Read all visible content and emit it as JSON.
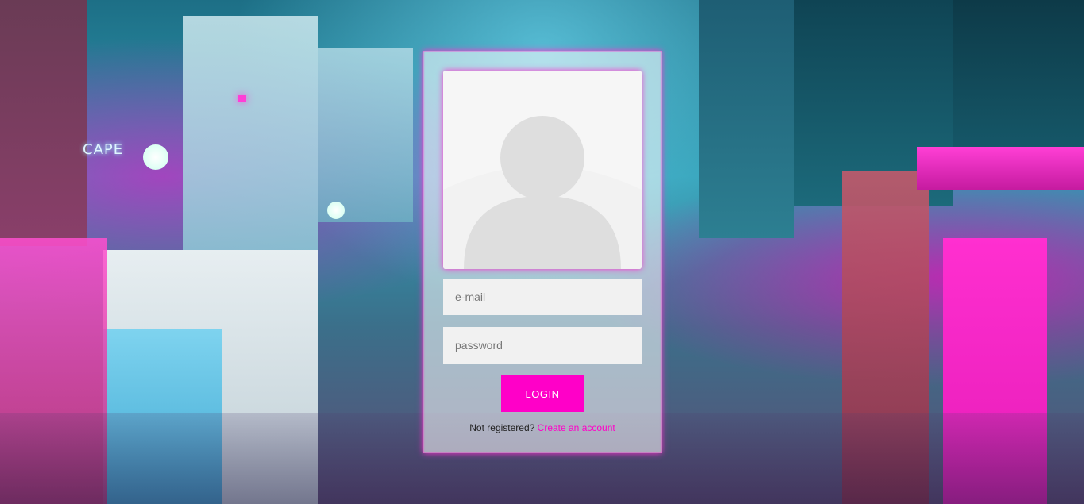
{
  "background": {
    "sign_text": "CAPE",
    "accent_color": "#ff00c8"
  },
  "login": {
    "avatar_icon": "user-silhouette-icon",
    "email_placeholder": "e-mail",
    "password_placeholder": "password",
    "login_label": "LOGIN",
    "not_registered_text": "Not registered?",
    "create_account_link": "Create an account"
  }
}
